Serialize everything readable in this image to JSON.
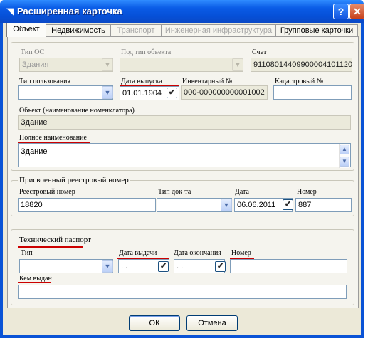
{
  "window": {
    "title": "Расширенная карточка",
    "help_glyph": "?",
    "close_glyph": "✕",
    "app_glyph": "◥"
  },
  "tabs": [
    {
      "label": "Объект",
      "state": "active"
    },
    {
      "label": "Недвижимость",
      "state": "normal"
    },
    {
      "label": "Транспорт",
      "state": "disabled"
    },
    {
      "label": "Инженерная инфраструктура",
      "state": "disabled"
    },
    {
      "label": "Групповые карточки",
      "state": "normal"
    }
  ],
  "object": {
    "os_type": {
      "label": "Тип ОС",
      "value": "Здания"
    },
    "subtype": {
      "label": "Под тип объекта",
      "value": ""
    },
    "account": {
      "label": "Счет",
      "value": "91108014409900004101120"
    },
    "usage_type": {
      "label": "Тип пользования",
      "value": ""
    },
    "release_date": {
      "label": "Дата выпуска",
      "value": "01.01.1904"
    },
    "inventory_no": {
      "label": "Инвентарный №",
      "value": "000-000000000001002"
    },
    "cadastral_no": {
      "label": "Кадастровый №",
      "value": ""
    },
    "nomenclature": {
      "label": "Объект (наименование номенклатора)",
      "value": "Здание"
    },
    "full_name": {
      "label": "Полное наименование",
      "value": "Здание"
    }
  },
  "registry": {
    "title": "Присвоенный реестровый номер",
    "number": {
      "label": "Реестровый номер",
      "value": "18820"
    },
    "doc_type": {
      "label": "Тип док-та",
      "value": ""
    },
    "date": {
      "label": "Дата",
      "value": "06.06.2011"
    },
    "doc_number": {
      "label": "Номер",
      "value": "887"
    }
  },
  "passport": {
    "title": "Технический паспорт",
    "type": {
      "label": "Тип",
      "value": ""
    },
    "issue_date": {
      "label": "Дата выдачи",
      "value": " . ."
    },
    "end_date": {
      "label": "Дата окончания",
      "value": " . ."
    },
    "number": {
      "label": "Номер",
      "value": ""
    },
    "issued_by": {
      "label": "Кем выдан",
      "value": ""
    }
  },
  "buttons": {
    "ok": "ОК",
    "cancel": "Отмена"
  },
  "icons": {
    "dropdown": "▼",
    "check": "✔",
    "scroll_up": "▲",
    "scroll_down": "▼"
  },
  "colors": {
    "annotation_red": "#cc0000",
    "title_blue": "#0a5ce6"
  }
}
